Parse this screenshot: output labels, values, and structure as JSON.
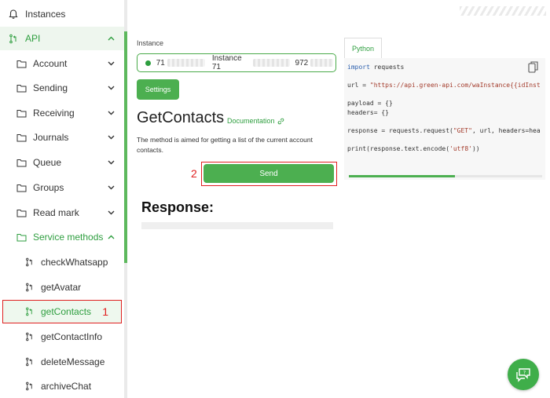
{
  "sidebar": {
    "instances": "Instances",
    "api": "API",
    "items": [
      "Account",
      "Sending",
      "Receiving",
      "Journals",
      "Queue",
      "Groups",
      "Read mark",
      "Service methods"
    ],
    "methods": [
      "checkWhatsapp",
      "getAvatar",
      "getContacts",
      "getContactInfo",
      "deleteMessage",
      "archiveChat"
    ],
    "selected_step": "1"
  },
  "instance": {
    "label": "Instance",
    "id_prefix": "71",
    "name_prefix": "Instance 71",
    "suffix": "972"
  },
  "settings_label": "Settings",
  "page_title": "GetContacts",
  "doc_link": "Documentation",
  "description": "The method is aimed for getting a list of the current account contacts.",
  "send_step": "2",
  "send_label": "Send",
  "response_title": "Response:",
  "code": {
    "tab": "Python",
    "lines": {
      "l1_kw": "import",
      "l1_rest": " requests",
      "l2_pre": "url = ",
      "l2_str": "\"https://api.green-api.com/waInstance{{idInst",
      "l3": "payload = {}",
      "l4": "headers= {}",
      "l5_pre": "response = requests.request(",
      "l5_str": "\"GET\"",
      "l5_post": ", url, headers=hea",
      "l6_pre": "print(response.text.encode(",
      "l6_str": "'utf8'",
      "l6_post": "))"
    }
  },
  "colors": {
    "accent": "#4caf50",
    "highlight": "#e02020"
  }
}
